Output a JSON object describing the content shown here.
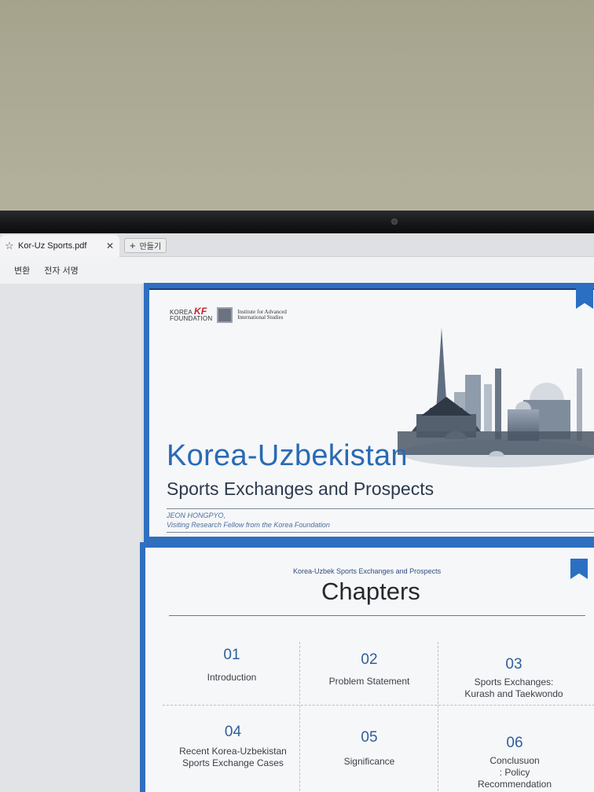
{
  "browser": {
    "tab_title": "Kor-Uz Sports.pdf",
    "new_tab_label": "만들기",
    "toolbar": [
      "변환",
      "전자 서명"
    ]
  },
  "slide1": {
    "logo_kf_line1": "KOREA",
    "logo_kf_line2": "FOUNDATION",
    "logo_kf_mark": "KF",
    "logo_iais_line1": "Institute for Advanced",
    "logo_iais_line2": "International Studies",
    "title": "Korea-Uzbekistan",
    "subtitle": "Sports Exchanges and Prospects",
    "author_name": "JEON HONGPYO,",
    "author_role": "Visiting Research Fellow from the Korea Foundation"
  },
  "slide2": {
    "kicker": "Korea-Uzbek Sports Exchanges and Prospects",
    "heading": "Chapters",
    "chapters": [
      {
        "num": "01",
        "label": "Introduction"
      },
      {
        "num": "02",
        "label": "Problem Statement"
      },
      {
        "num": "03",
        "label": "Sports Exchanges:\nKurash and Taekwondo"
      },
      {
        "num": "04",
        "label": "Recent Korea-Uzbekistan\nSports Exchange Cases"
      },
      {
        "num": "05",
        "label": "Significance"
      },
      {
        "num": "06",
        "label": "Conclusuon\n: Policy\nRecommendation"
      }
    ]
  },
  "colors": {
    "accent_blue": "#2f6fc0",
    "title_blue": "#2a6ab5",
    "logo_red": "#c4252b"
  }
}
